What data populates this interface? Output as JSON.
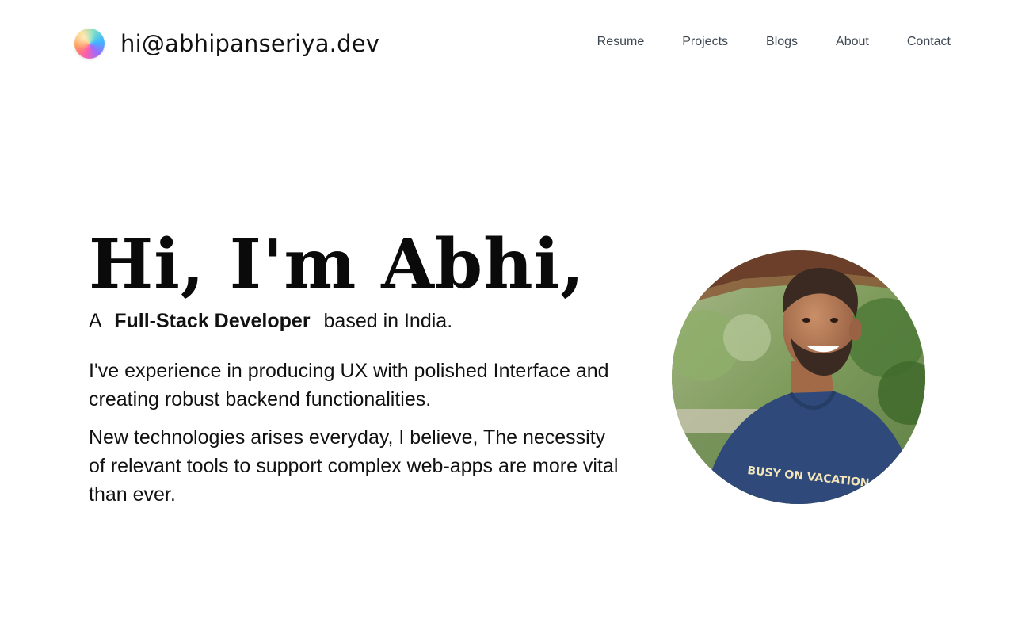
{
  "header": {
    "brand_text": "hi@abhipanseriya.dev",
    "nav": [
      {
        "label": "Resume"
      },
      {
        "label": "Projects"
      },
      {
        "label": "Blogs"
      },
      {
        "label": "About"
      },
      {
        "label": "Contact"
      }
    ]
  },
  "hero": {
    "heading": "Hi, I'm Abhi,",
    "tagline_prefix": "A",
    "tagline_role": "Full-Stack Developer",
    "tagline_suffix": "based in India.",
    "paragraphs": [
      "I've experience in producing UX with polished Interface and creating robust backend functionalities.",
      "New technologies arises everyday, I believe, The necessity of relevant tools to support complex web-apps are more vital than ever."
    ]
  },
  "portrait": {
    "shirt_text": "BUSY ON VACATION"
  },
  "colors": {
    "nav_text": "#3d4752",
    "heading": "#0a0a0a",
    "shirt": "#2f4a7a"
  }
}
